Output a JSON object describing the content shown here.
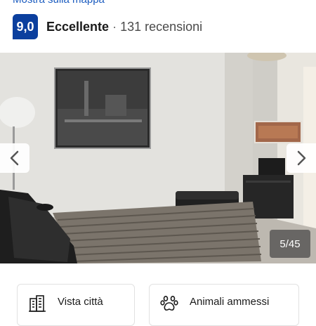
{
  "header": {
    "map_link": "Mostra sulla mappa",
    "score": "9,0",
    "rating_label": "Eccellente",
    "separator": "·",
    "reviews": "131 recensioni",
    "badge_color": "#0b3f9e",
    "link_color": "#1a5bbf"
  },
  "gallery": {
    "counter": "5/45",
    "current": 5,
    "total": 45,
    "prev_icon": "chevron-left-icon",
    "next_icon": "chevron-right-icon"
  },
  "features": [
    {
      "label": "Vista città",
      "icon": "city-building-icon"
    },
    {
      "label": "Animali ammessi",
      "icon": "paw-icon"
    }
  ]
}
